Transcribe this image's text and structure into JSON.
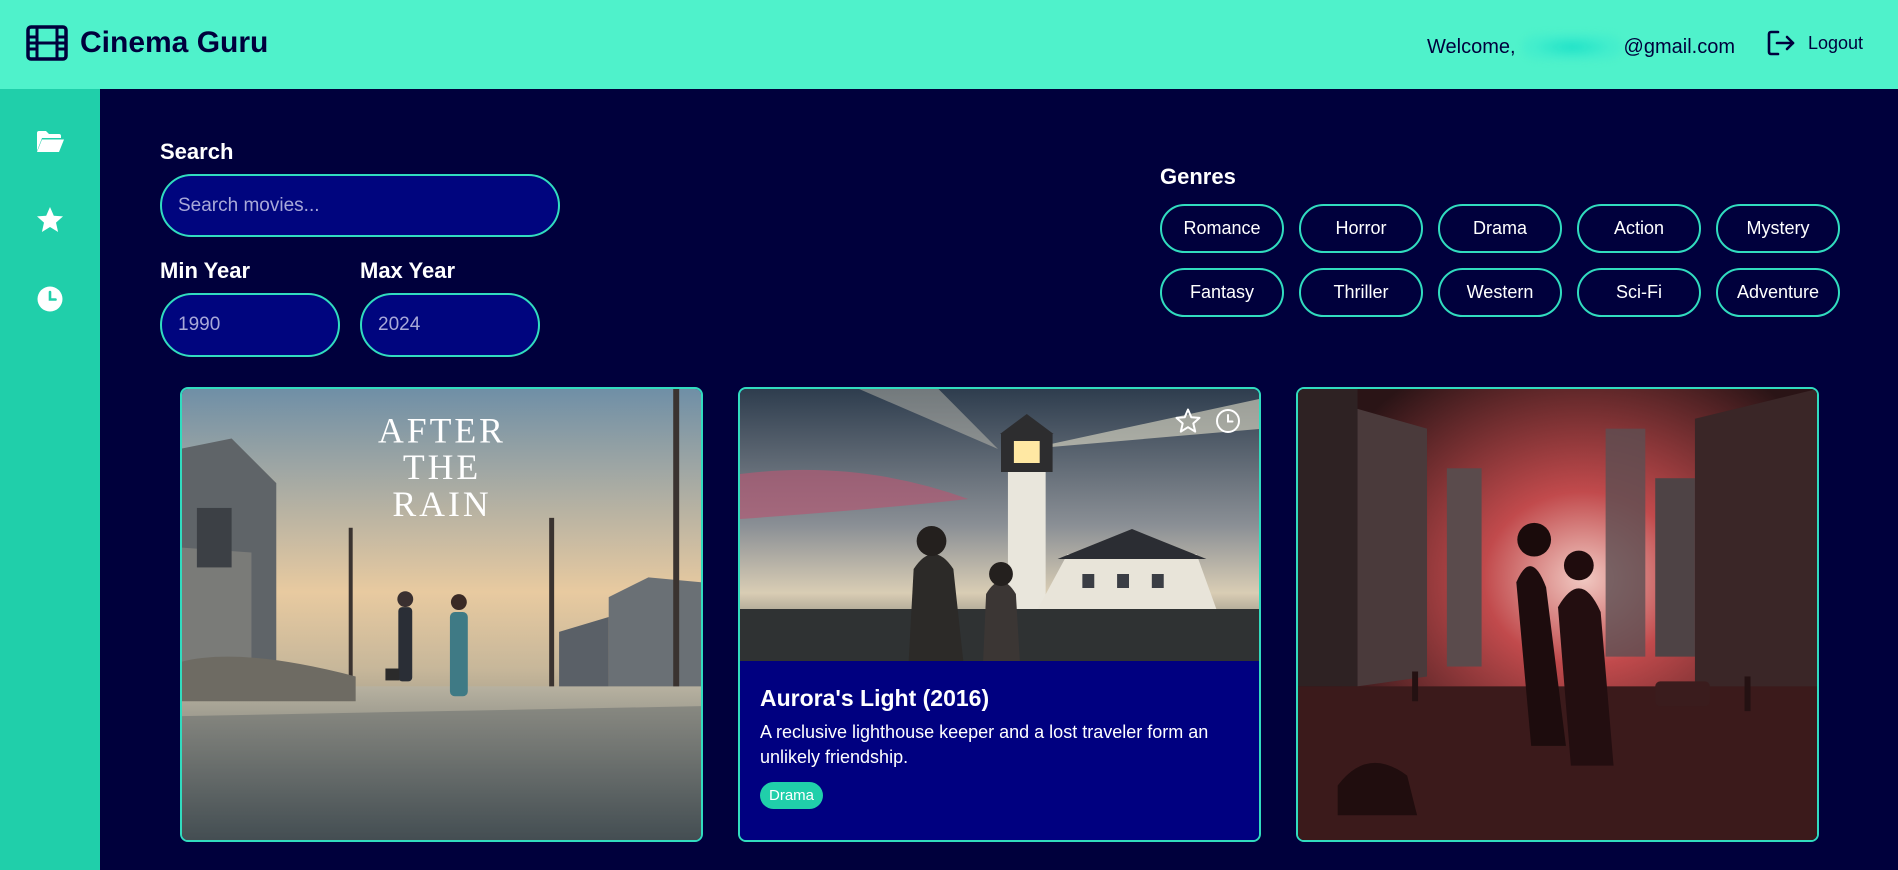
{
  "header": {
    "app_title": "Cinema Guru",
    "brand_icon": "film-icon",
    "welcome_prefix": "Welcome,",
    "welcome_email_suffix": "@gmail.com",
    "logout_label": "Logout",
    "logout_icon": "logout-icon",
    "bg_color": "#4ff2cb"
  },
  "sidebar": {
    "bg_color": "#20cfaa",
    "items": [
      {
        "icon": "folder-icon"
      },
      {
        "icon": "star-icon"
      },
      {
        "icon": "clock-icon"
      }
    ]
  },
  "filters": {
    "search_label": "Search",
    "search_placeholder": "Search movies...",
    "min_year_label": "Min Year",
    "min_year_placeholder": "1990",
    "max_year_label": "Max Year",
    "max_year_placeholder": "2024",
    "genres_label": "Genres",
    "genres": [
      "Romance",
      "Horror",
      "Drama",
      "Action",
      "Mystery",
      "Fantasy",
      "Thriller",
      "Western",
      "Sci-Fi",
      "Adventure"
    ]
  },
  "movies": [
    {
      "poster_text": [
        "AFTER",
        "THE",
        "RAIN"
      ]
    },
    {
      "title": "Aurora's Light (2016)",
      "description": "A reclusive lighthouse keeper and a lost traveler form an unlikely friendship.",
      "genre_tag": "Drama",
      "actions": [
        "star-icon",
        "clock-icon"
      ]
    },
    {}
  ],
  "colors": {
    "page_bg": "#00003c",
    "accent": "#31dcbf",
    "input_bg": "#00057e",
    "card_body": "#000080"
  }
}
